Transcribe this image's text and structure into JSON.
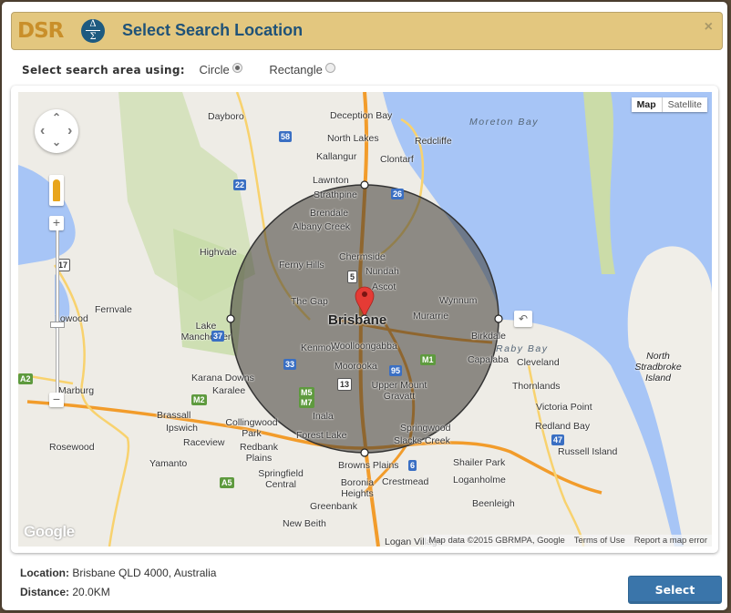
{
  "dialog": {
    "logo_text": "DSR",
    "logo_symbol_top": "Δ",
    "logo_symbol_bottom": "Σ",
    "title": "Select Search Location",
    "close_icon": "×"
  },
  "options": {
    "label": "Select search area using:",
    "choices": [
      {
        "label": "Circle",
        "selected": true
      },
      {
        "label": "Rectangle",
        "selected": false
      }
    ]
  },
  "map": {
    "map_type": {
      "map": "Map",
      "satellite": "Satellite",
      "active": "Map"
    },
    "pan_icons": {
      "up": "⌃",
      "down": "⌄",
      "left": "‹",
      "right": "›"
    },
    "zoom_in": "+",
    "zoom_out": "−",
    "undo_icon": "↶",
    "google_logo": "Google",
    "attribution": {
      "data": "Map data ©2015 GBRMPA, Google",
      "terms": "Terms of Use",
      "report": "Report a map error"
    },
    "center_label": "Brisbane",
    "places": [
      "Dayboro",
      "Deception Bay",
      "North Lakes",
      "Redcliffe",
      "Kallangur",
      "Clontarf",
      "Lawnton",
      "Strathpine",
      "Brendale",
      "Albany Creek",
      "Highvale",
      "Ferny Hills",
      "Chermside",
      "Nundah",
      "Ascot",
      "The Gap",
      "Wynnum",
      "Murarrie",
      "Fernvale",
      "Lake Manchester",
      "Kenmore",
      "Woolloongabba",
      "Birkdale",
      "Capalaba",
      "Cleveland",
      "Karana Downs",
      "Karalee",
      "Moorooka",
      "Upper Mount Gravatt",
      "Thornlands",
      "Marburg",
      "Lowood",
      "Brassall",
      "Ipswich",
      "Collingwood Park",
      "Inala",
      "Victoria Point",
      "Raceview",
      "Redbank Plains",
      "Forest Lake",
      "Springwood",
      "Slacks Creek",
      "Redland Bay",
      "Rosewood",
      "Yamanto",
      "Springfield Central",
      "Browns Plains",
      "Shailer Park",
      "Russell Island",
      "Boronia Heights",
      "Crestmead",
      "Loganholme",
      "Greenbank",
      "Beenleigh",
      "New Beith",
      "Logan Village"
    ],
    "water_labels": [
      "Moreton Bay",
      "Raby Bay"
    ],
    "island_label": "North Stradbroke Island",
    "route_shields": [
      "58",
      "22",
      "17",
      "26",
      "5",
      "37",
      "33",
      "95",
      "M1",
      "M2",
      "M5",
      "M7",
      "A2",
      "A5",
      "13",
      "6",
      "47"
    ]
  },
  "footer": {
    "location_label": "Location:",
    "location_value": "Brisbane QLD 4000, Australia",
    "distance_label": "Distance:",
    "distance_value": "20.0KM",
    "select_button": "Select"
  }
}
